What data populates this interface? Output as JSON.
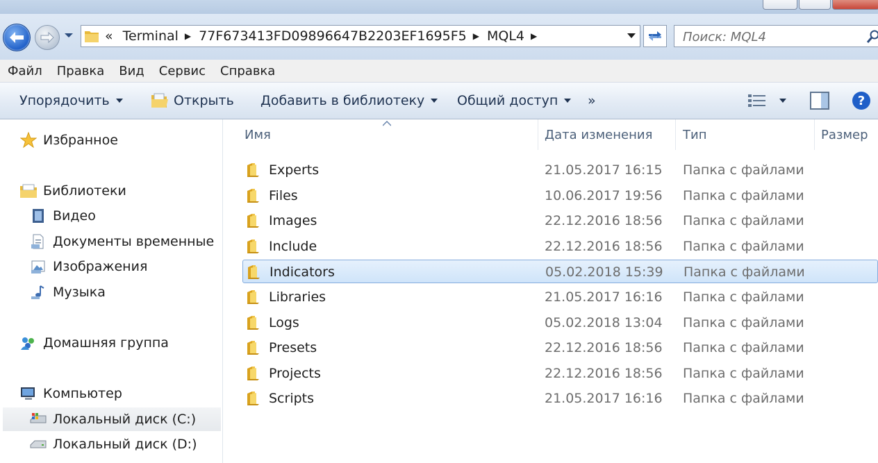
{
  "address": {
    "overflow": "«",
    "crumbs": [
      "Terminal",
      "77F673413FD09896647B2203EF1695F5",
      "MQL4"
    ]
  },
  "search": {
    "placeholder": "Поиск: MQL4"
  },
  "menu": [
    "Файл",
    "Правка",
    "Вид",
    "Сервис",
    "Справка"
  ],
  "toolbar": {
    "organize": "Упорядочить",
    "open": "Открыть",
    "add_library": "Добавить в библиотеку",
    "share": "Общий доступ",
    "more": "»"
  },
  "nav": {
    "favorites": "Избранное",
    "libraries": "Библиотеки",
    "library_items": [
      "Видео",
      "Документы временные",
      "Изображения",
      "Музыка"
    ],
    "homegroup": "Домашняя группа",
    "computer": "Компьютер",
    "drives": [
      "Локальный диск (C:)",
      "Локальный диск (D:)"
    ]
  },
  "columns": {
    "name": "Имя",
    "date": "Дата изменения",
    "type": "Тип",
    "size": "Размер"
  },
  "files": [
    {
      "name": "Experts",
      "date": "21.05.2017 16:15",
      "type": "Папка с файлами"
    },
    {
      "name": "Files",
      "date": "10.06.2017 19:56",
      "type": "Папка с файлами"
    },
    {
      "name": "Images",
      "date": "22.12.2016 18:56",
      "type": "Папка с файлами"
    },
    {
      "name": "Include",
      "date": "22.12.2016 18:56",
      "type": "Папка с файлами"
    },
    {
      "name": "Indicators",
      "date": "05.02.2018 15:39",
      "type": "Папка с файлами"
    },
    {
      "name": "Libraries",
      "date": "21.05.2017 16:16",
      "type": "Папка с файлами"
    },
    {
      "name": "Logs",
      "date": "05.02.2018 13:04",
      "type": "Папка с файлами"
    },
    {
      "name": "Presets",
      "date": "22.12.2016 18:56",
      "type": "Папка с файлами"
    },
    {
      "name": "Projects",
      "date": "22.12.2016 18:56",
      "type": "Папка с файлами"
    },
    {
      "name": "Scripts",
      "date": "21.05.2017 16:16",
      "type": "Папка с файлами"
    }
  ],
  "selected_file": "Indicators",
  "selected_drive": "Локальный диск (C:)",
  "colors": {
    "accent": "#1f5fc8",
    "folder": "#f2c94c",
    "selection": "#cfe4fa"
  }
}
